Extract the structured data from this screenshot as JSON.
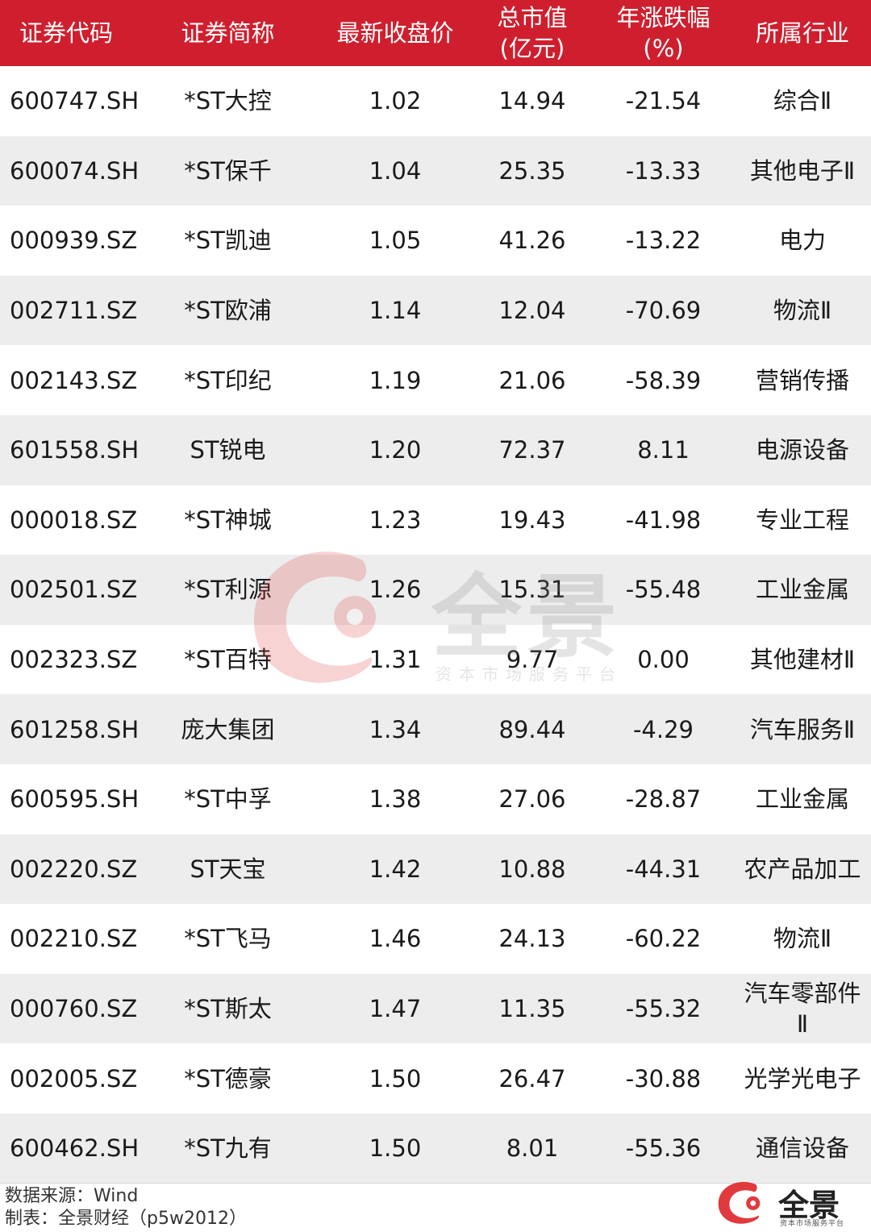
{
  "table": {
    "headers": [
      "证券代码",
      "证券简称",
      "最新收盘价",
      "总市值\n(亿元)",
      "年涨跌幅\n(%)",
      "所属行业"
    ],
    "rows": [
      [
        "600747.SH",
        "*ST大控",
        "1.02",
        "14.94",
        "-21.54",
        "综合Ⅱ"
      ],
      [
        "600074.SH",
        "*ST保千",
        "1.04",
        "25.35",
        "-13.33",
        "其他电子Ⅱ"
      ],
      [
        "000939.SZ",
        "*ST凯迪",
        "1.05",
        "41.26",
        "-13.22",
        "电力"
      ],
      [
        "002711.SZ",
        "*ST欧浦",
        "1.14",
        "12.04",
        "-70.69",
        "物流Ⅱ"
      ],
      [
        "002143.SZ",
        "*ST印纪",
        "1.19",
        "21.06",
        "-58.39",
        "营销传播"
      ],
      [
        "601558.SH",
        "ST锐电",
        "1.20",
        "72.37",
        "8.11",
        "电源设备"
      ],
      [
        "000018.SZ",
        "*ST神城",
        "1.23",
        "19.43",
        "-41.98",
        "专业工程"
      ],
      [
        "002501.SZ",
        "*ST利源",
        "1.26",
        "15.31",
        "-55.48",
        "工业金属"
      ],
      [
        "002323.SZ",
        "*ST百特",
        "1.31",
        "9.77",
        "0.00",
        "其他建材Ⅱ"
      ],
      [
        "601258.SH",
        "庞大集团",
        "1.34",
        "89.44",
        "-4.29",
        "汽车服务Ⅱ"
      ],
      [
        "600595.SH",
        "*ST中孚",
        "1.38",
        "27.06",
        "-28.87",
        "工业金属"
      ],
      [
        "002220.SZ",
        "ST天宝",
        "1.42",
        "10.88",
        "-44.31",
        "农产品加工"
      ],
      [
        "002210.SZ",
        "*ST飞马",
        "1.46",
        "24.13",
        "-60.22",
        "物流Ⅱ"
      ],
      [
        "000760.SZ",
        "*ST斯太",
        "1.47",
        "11.35",
        "-55.32",
        "汽车零部件\nⅡ"
      ],
      [
        "002005.SZ",
        "*ST德豪",
        "1.50",
        "26.47",
        "-30.88",
        "光学光电子"
      ],
      [
        "600462.SH",
        "*ST九有",
        "1.50",
        "8.01",
        "-55.36",
        "通信设备"
      ]
    ]
  },
  "watermark": {
    "brand": "全景",
    "tagline": "资本市场服务平台"
  },
  "footer": {
    "source": "数据来源：Wind",
    "maker": "制表：全景财经（p5w2012）"
  },
  "logo": {
    "brand": "全景",
    "tagline": "资本市场服务平台"
  },
  "colors": {
    "header_bg": "#cf1f2e",
    "row_alt_bg": "#ededed",
    "brand_red": "#e03a3e"
  }
}
